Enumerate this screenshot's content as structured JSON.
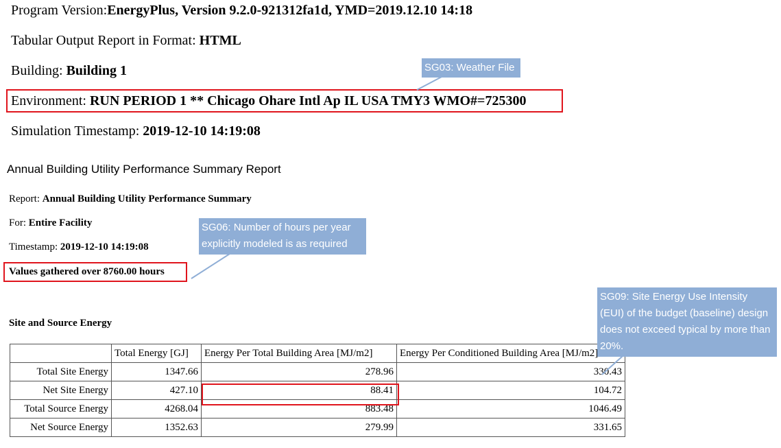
{
  "header": {
    "program_label": "Program Version:",
    "program_value": "EnergyPlus, Version 9.2.0-921312fa1d, YMD=2019.12.10 14:18",
    "format_label": "Tabular Output Report in Format: ",
    "format_value": "HTML",
    "building_label": "Building: ",
    "building_value": "Building 1",
    "environment_label": "Environment: ",
    "environment_value": "RUN PERIOD 1 ** Chicago Ohare Intl Ap IL USA TMY3 WMO#=725300",
    "timestamp_label": "Simulation Timestamp: ",
    "timestamp_value": "2019-12-10 14:19:08"
  },
  "report": {
    "section_title": "Annual Building Utility Performance Summary Report",
    "report_label": "Report: ",
    "report_value": "Annual Building Utility Performance Summary",
    "for_label": "For: ",
    "for_value": "Entire Facility",
    "timestamp_label": "Timestamp: ",
    "timestamp_value": "2019-12-10 14:19:08",
    "values_gathered": "Values gathered over 8760.00 hours"
  },
  "table": {
    "title": "Site and Source Energy",
    "headers": [
      "",
      "Total Energy [GJ]",
      "Energy Per Total Building Area [MJ/m2]",
      "Energy Per Conditioned Building Area [MJ/m2]"
    ],
    "rows": [
      [
        "Total Site Energy",
        "1347.66",
        "278.96",
        "330.43"
      ],
      [
        "Net Site Energy",
        "427.10",
        "88.41",
        "104.72"
      ],
      [
        "Total Source Energy",
        "4268.04",
        "883.48",
        "1046.49"
      ],
      [
        "Net Source Energy",
        "1352.63",
        "279.99",
        "331.65"
      ]
    ]
  },
  "callouts": {
    "sg03": "SG03: Weather File",
    "sg06": "SG06: Number of hours per year explicitly modeled is as required",
    "sg09": "SG09: Site Energy Use Intensity (EUI) of the budget (baseline) design does not exceed typical by more than 20%."
  },
  "colors": {
    "highlight_border": "#e0141c",
    "callout_fill": "#8faed6",
    "callout_text": "#ffffff"
  }
}
